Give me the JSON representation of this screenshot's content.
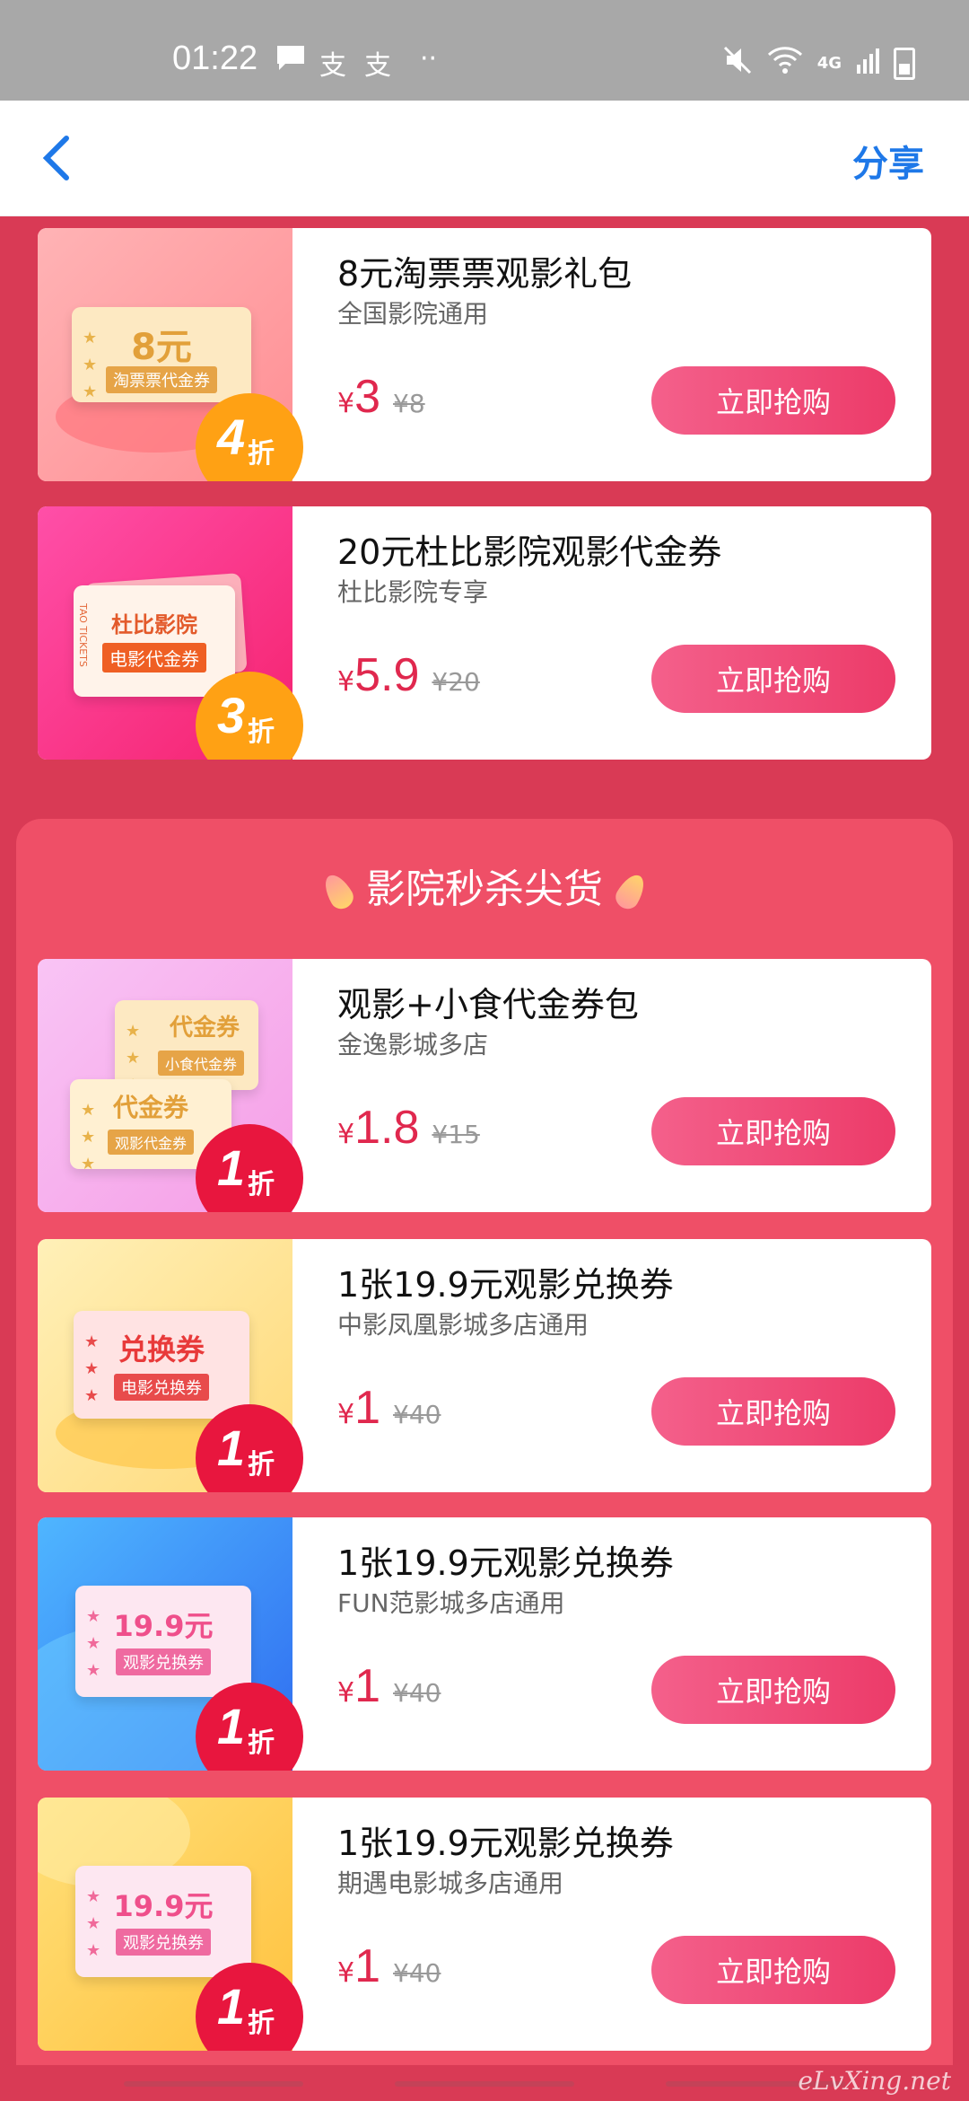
{
  "status_bar": {
    "time": "01:22",
    "network": "4G"
  },
  "navbar": {
    "share_label": "分享"
  },
  "section": {
    "title": "影院秒杀尖货"
  },
  "cards": [
    {
      "title": "8元淘票票观影礼包",
      "subtitle": "全国影院通用",
      "currency": "¥",
      "price": "3",
      "original_price": "¥8",
      "buy_label": "立即抢购",
      "discount_num": "4",
      "discount_unit": "折",
      "ticket_main": "8元",
      "ticket_sub": "淘票票代金券"
    },
    {
      "title": "20元杜比影院观影代金券",
      "subtitle": "杜比影院专享",
      "currency": "¥",
      "price": "5.9",
      "original_price": "¥20",
      "buy_label": "立即抢购",
      "discount_num": "3",
      "discount_unit": "折",
      "ticket_main": "杜比影院",
      "ticket_sub": "电影代金券",
      "ticket_side": "TAO TICKETS"
    },
    {
      "title": "观影+小食代金券包",
      "subtitle": "金逸影城多店",
      "currency": "¥",
      "price": "1.8",
      "original_price": "¥15",
      "buy_label": "立即抢购",
      "discount_num": "1",
      "discount_unit": "折",
      "ticket_main": "代金券",
      "ticket_sub": "观影代金券",
      "ticket2_main": "代金券",
      "ticket2_sub": "小食代金券"
    },
    {
      "title": "1张19.9元观影兑换券",
      "subtitle": "中影凤凰影城多店通用",
      "currency": "¥",
      "price": "1",
      "original_price": "¥40",
      "buy_label": "立即抢购",
      "discount_num": "1",
      "discount_unit": "折",
      "ticket_main": "兑换券",
      "ticket_sub": "电影兑换券"
    },
    {
      "title": "1张19.9元观影兑换券",
      "subtitle": "FUN范影城多店通用",
      "currency": "¥",
      "price": "1",
      "original_price": "¥40",
      "buy_label": "立即抢购",
      "discount_num": "1",
      "discount_unit": "折",
      "ticket_main": "19.9元",
      "ticket_sub": "观影兑换券"
    },
    {
      "title": "1张19.9元观影兑换券",
      "subtitle": "期遇电影城多店通用",
      "currency": "¥",
      "price": "1",
      "original_price": "¥40",
      "buy_label": "立即抢购",
      "discount_num": "1",
      "discount_unit": "折",
      "ticket_main": "19.9元",
      "ticket_sub": "观影兑换券"
    }
  ],
  "watermark": "eLvXing.net",
  "colors": {
    "page_bg": "#d93a55",
    "section_bg": "#ef4f67",
    "accent_price": "#e0284e",
    "share_blue": "#1e78e8"
  }
}
